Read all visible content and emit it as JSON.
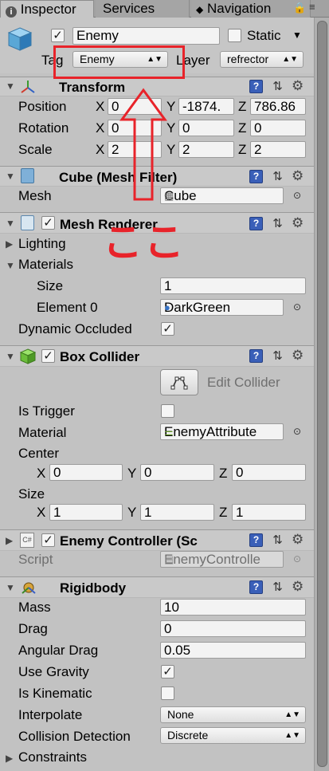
{
  "tabs": [
    {
      "label": "Inspector",
      "icon": "info-icon"
    },
    {
      "label": "Services"
    },
    {
      "label": "Navigation",
      "icon": "navigation-icon"
    }
  ],
  "header": {
    "object_name": "Enemy",
    "static_label": "Static",
    "tag_label": "Tag",
    "tag_value": "Enemy",
    "layer_label": "Layer",
    "layer_value": "refrector"
  },
  "annotation": {
    "text": "ここ",
    "color": "#e8232a"
  },
  "transform": {
    "title": "Transform",
    "rows": [
      {
        "label": "Position",
        "x": "0",
        "y": "-1874.",
        "z": "786.86"
      },
      {
        "label": "Rotation",
        "x": "0",
        "y": "0",
        "z": "0"
      },
      {
        "label": "Scale",
        "x": "2",
        "y": "2",
        "z": "2"
      }
    ],
    "axis": {
      "x": "X",
      "y": "Y",
      "z": "Z"
    }
  },
  "mesh_filter": {
    "title": "Cube (Mesh Filter)",
    "mesh_label": "Mesh",
    "mesh_value": "Cube"
  },
  "mesh_renderer": {
    "title": "Mesh Renderer",
    "lighting_label": "Lighting",
    "materials_label": "Materials",
    "size_label": "Size",
    "size_value": "1",
    "element0_label": "Element 0",
    "element0_value": "DarkGreen",
    "dynamic_occluded_label": "Dynamic Occluded"
  },
  "box_collider": {
    "title": "Box Collider",
    "edit_collider_label": "Edit Collider",
    "is_trigger_label": "Is Trigger",
    "material_label": "Material",
    "material_value": "EnemyAttribute",
    "center_label": "Center",
    "center": {
      "x": "0",
      "y": "0",
      "z": "0"
    },
    "size_label": "Size",
    "size": {
      "x": "1",
      "y": "1",
      "z": "1"
    }
  },
  "enemy_controller": {
    "title": "Enemy Controller (Sc",
    "script_label": "Script",
    "script_value": "EnemyControlle"
  },
  "rigidbody": {
    "title": "Rigidbody",
    "mass_label": "Mass",
    "mass_value": "10",
    "drag_label": "Drag",
    "drag_value": "0",
    "angular_drag_label": "Angular Drag",
    "angular_drag_value": "0.05",
    "use_gravity_label": "Use Gravity",
    "is_kinematic_label": "Is Kinematic",
    "interpolate_label": "Interpolate",
    "interpolate_value": "None",
    "collision_label": "Collision Detection",
    "collision_value": "Discrete",
    "constraints_label": "Constraints"
  }
}
